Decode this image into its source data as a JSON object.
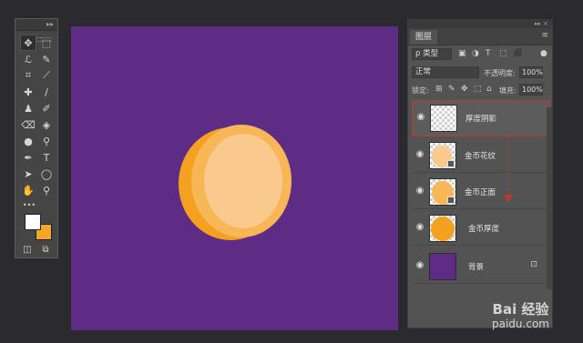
{
  "toolbox": {
    "collapse_glyph": "▸▸",
    "close_glyph": "×",
    "tools": [
      {
        "icon": "move-tool-icon",
        "glyph": "✥"
      },
      {
        "icon": "marquee-tool-icon",
        "glyph": "⬚"
      },
      {
        "icon": "lasso-tool-icon",
        "glyph": "ℒ"
      },
      {
        "icon": "magic-wand-icon",
        "glyph": "✎"
      },
      {
        "icon": "crop-tool-icon",
        "glyph": "⌗"
      },
      {
        "icon": "eyedropper-icon",
        "glyph": "⟋"
      },
      {
        "icon": "healing-brush-icon",
        "glyph": "✚"
      },
      {
        "icon": "brush-tool-icon",
        "glyph": "∕"
      },
      {
        "icon": "stamp-tool-icon",
        "glyph": "♟"
      },
      {
        "icon": "history-brush-icon",
        "glyph": "✐"
      },
      {
        "icon": "eraser-tool-icon",
        "glyph": "⌫"
      },
      {
        "icon": "paint-bucket-icon",
        "glyph": "◈"
      },
      {
        "icon": "blur-tool-icon",
        "glyph": "●"
      },
      {
        "icon": "dodge-tool-icon",
        "glyph": "⚲"
      },
      {
        "icon": "pen-tool-icon",
        "glyph": "✒"
      },
      {
        "icon": "type-tool-icon",
        "glyph": "T"
      },
      {
        "icon": "path-select-icon",
        "glyph": "➤"
      },
      {
        "icon": "ellipse-tool-icon",
        "glyph": "◯"
      },
      {
        "icon": "hand-tool-icon",
        "glyph": "✋"
      },
      {
        "icon": "zoom-tool-icon",
        "glyph": "⚲"
      }
    ],
    "more_glyph": "•••",
    "foreground_color": "#ffffff",
    "background_color": "#f4a627",
    "quickmask_glyph": "◫",
    "screenmode_glyph": "⧉"
  },
  "canvas": {
    "background_color": "#5e2c84",
    "coin": {
      "edge_color": "#f4a021",
      "face_color": "#f8c16a",
      "inner_color": "#f9c98d"
    }
  },
  "layers_panel": {
    "tab_label": "图层",
    "menu_glyph": "≡",
    "filter": {
      "label": "ρ 类型",
      "glyph": "⌄"
    },
    "filter_icons": [
      "▣",
      "◑",
      "T",
      "⬚",
      "⬛"
    ],
    "blend_mode": "正常",
    "opacity_label": "不透明度:",
    "opacity_value": "100%",
    "lock_label": "锁定:",
    "lock_icons": [
      "⊞",
      "✎",
      "✥",
      "⬚",
      "🔒"
    ],
    "fill_label": "填充:",
    "fill_value": "100%",
    "layers": [
      {
        "name": "厚度阴影",
        "thumb": "transparent",
        "selected": true
      },
      {
        "name": "金币花纹",
        "thumb": "pale",
        "clipped": true
      },
      {
        "name": "金币正面",
        "thumb": "light",
        "clipped": true
      },
      {
        "name": "金币厚度",
        "thumb": "orange"
      },
      {
        "name": "背景",
        "thumb": "purple",
        "locked": true
      }
    ],
    "highlight_color": "#c0392b"
  },
  "watermark": {
    "brand": "Bai 经验",
    "url": "paidu.com"
  }
}
